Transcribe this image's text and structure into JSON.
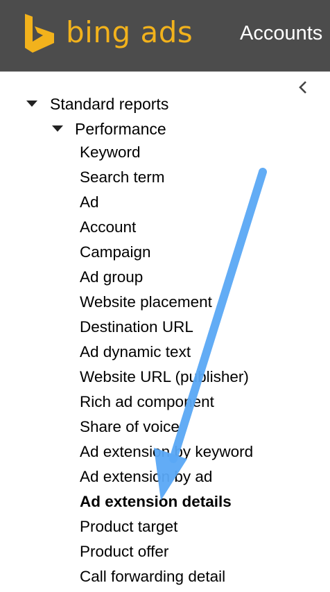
{
  "header": {
    "brand": "bing ads",
    "nav_accounts": "Accounts"
  },
  "colors": {
    "header_bg": "#4c4c4c",
    "brand_orange": "#f2b21c",
    "annotation_arrow": "#5aa8f5"
  },
  "icons": {
    "logo": "bing-logo-icon",
    "collapse": "chevron-left-icon",
    "expand": "triangle-down-icon"
  },
  "tree": {
    "root_label": "Standard reports",
    "group_label": "Performance",
    "items": [
      {
        "label": "Keyword"
      },
      {
        "label": "Search term"
      },
      {
        "label": "Ad"
      },
      {
        "label": "Account"
      },
      {
        "label": "Campaign"
      },
      {
        "label": "Ad group"
      },
      {
        "label": "Website placement"
      },
      {
        "label": "Destination URL"
      },
      {
        "label": "Ad dynamic text"
      },
      {
        "label": "Website URL (publisher)"
      },
      {
        "label": "Rich ad component"
      },
      {
        "label": "Share of voice"
      },
      {
        "label": "Ad extension by keyword"
      },
      {
        "label": "Ad extension by ad"
      },
      {
        "label": "Ad extension details",
        "selected": true
      },
      {
        "label": "Product target"
      },
      {
        "label": "Product offer"
      },
      {
        "label": "Call forwarding detail"
      }
    ]
  }
}
